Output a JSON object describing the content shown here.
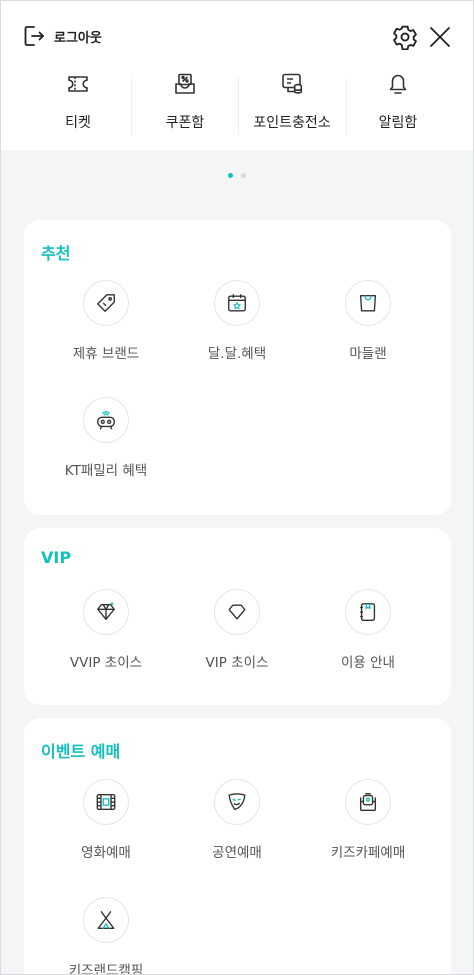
{
  "header": {
    "logout_label": "로그아웃"
  },
  "quick_menu": [
    {
      "label": "티켓",
      "icon": "ticket-icon"
    },
    {
      "label": "쿠폰함",
      "icon": "coupon-box-icon"
    },
    {
      "label": "포인트충전소",
      "icon": "point-charge-icon"
    },
    {
      "label": "알림함",
      "icon": "bell-icon"
    }
  ],
  "pager": {
    "active_index": 0,
    "count": 2,
    "active_color": "#14bfbf",
    "inactive_color": "#d7dadd"
  },
  "sections": {
    "recommend": {
      "title": "추천",
      "items": [
        {
          "label": "제휴 브랜드",
          "icon": "tag-icon"
        },
        {
          "label": "달.달.혜택",
          "icon": "calendar-icon"
        },
        {
          "label": "마들랜",
          "icon": "shopping-bag-icon"
        },
        {
          "label": "KT패밀리 혜택",
          "icon": "robot-icon"
        }
      ]
    },
    "vip": {
      "title": "VIP",
      "items": [
        {
          "label": "VVIP 초이스",
          "icon": "diamond-sparkle-icon"
        },
        {
          "label": "VIP 초이스",
          "icon": "diamond-icon"
        },
        {
          "label": "이용 안내",
          "icon": "notebook-icon"
        }
      ]
    },
    "event": {
      "title": "이벤트 예매",
      "items": [
        {
          "label": "영화예매",
          "icon": "film-icon"
        },
        {
          "label": "공연예매",
          "icon": "theater-mask-icon"
        },
        {
          "label": "키즈카페예매",
          "icon": "kids-cafe-icon"
        },
        {
          "label": "키즈랜드캠핑",
          "icon": "tent-icon"
        }
      ]
    }
  },
  "colors": {
    "accent": "#14bfbf",
    "background": "#f3f5f7"
  }
}
